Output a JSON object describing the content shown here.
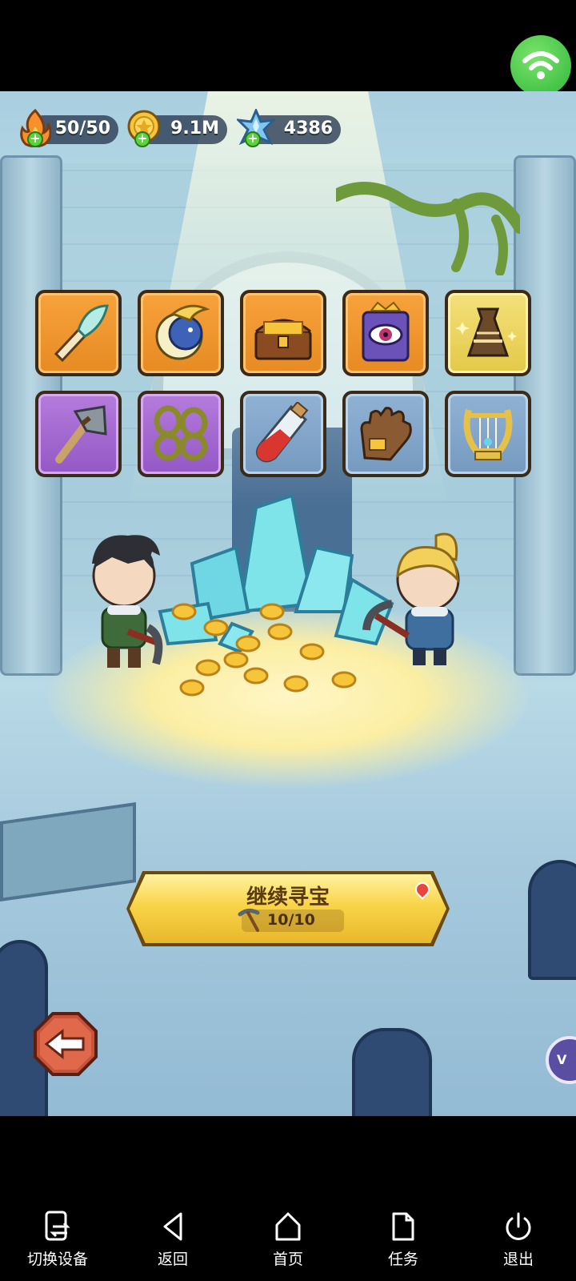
{
  "hud": {
    "energy": {
      "value": "50/50",
      "icon": "flame-icon"
    },
    "gold": {
      "value": "9.1M",
      "icon": "gold-coin-icon"
    },
    "gems": {
      "value": "4386",
      "icon": "crystal-icon"
    }
  },
  "items": [
    {
      "name": "feather-horn",
      "rarity": "orange"
    },
    {
      "name": "moon-spirit-orb",
      "rarity": "orange"
    },
    {
      "name": "treasure-chest",
      "rarity": "orange"
    },
    {
      "name": "eye-tome",
      "rarity": "orange"
    },
    {
      "name": "sparkling-vase",
      "rarity": "yellow"
    },
    {
      "name": "stone-axe",
      "rarity": "purple"
    },
    {
      "name": "thorn-vine-chains",
      "rarity": "purple"
    },
    {
      "name": "red-potion",
      "rarity": "blue"
    },
    {
      "name": "leather-glove",
      "rarity": "blue"
    },
    {
      "name": "golden-lyre",
      "rarity": "blue"
    }
  ],
  "continue_button": {
    "label": "继续寻宝",
    "pickaxe_count": "10/10"
  },
  "colors": {
    "button_yellow": "#f8d447",
    "wifi_green": "#2fb73a",
    "nav_bg": "#000000"
  },
  "nav": [
    {
      "label": "切换设备",
      "icon": "switch-device-icon"
    },
    {
      "label": "返回",
      "icon": "back-triangle-icon"
    },
    {
      "label": "首页",
      "icon": "home-icon"
    },
    {
      "label": "任务",
      "icon": "task-document-icon"
    },
    {
      "label": "退出",
      "icon": "power-icon"
    }
  ]
}
